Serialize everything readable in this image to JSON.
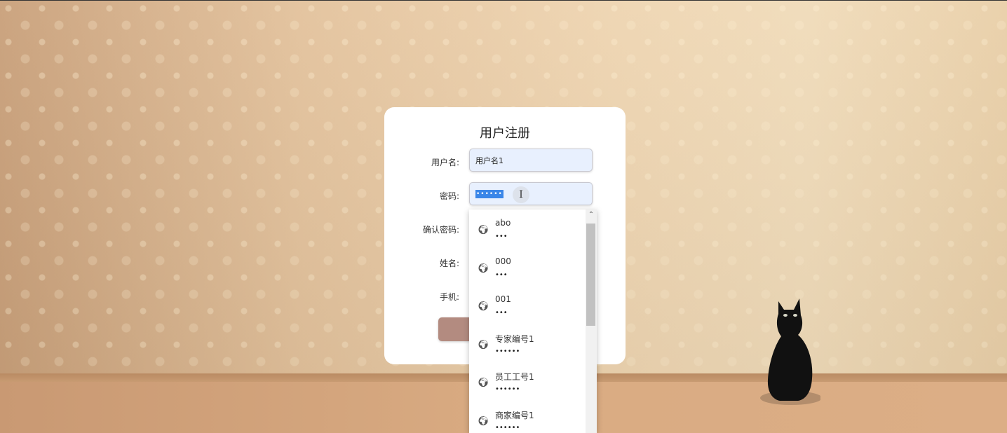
{
  "form": {
    "title": "用户注册",
    "fields": [
      {
        "label": "用户名:",
        "value": "用户名1"
      },
      {
        "label": "密码:",
        "value": "••••••"
      },
      {
        "label": "确认密码:",
        "value": ""
      },
      {
        "label": "姓名:",
        "value": ""
      },
      {
        "label": "手机:",
        "value": ""
      }
    ],
    "cursor_glyph": "I"
  },
  "autofill": {
    "scroll_up_glyph": "⌃",
    "icon": "globe-icon",
    "items": [
      {
        "name": "abo",
        "password": "•••"
      },
      {
        "name": "000",
        "password": "•••"
      },
      {
        "name": "001",
        "password": "•••"
      },
      {
        "name": "专家编号1",
        "password": "••••••"
      },
      {
        "name": "员工工号1",
        "password": "••••••"
      },
      {
        "name": "商家编号1",
        "password": "••••••"
      }
    ]
  },
  "colors": {
    "card": "#ffffff",
    "field_autofill": "#e8f0fe",
    "selection": "#3a86e8",
    "submit_button": "#b38b80"
  }
}
